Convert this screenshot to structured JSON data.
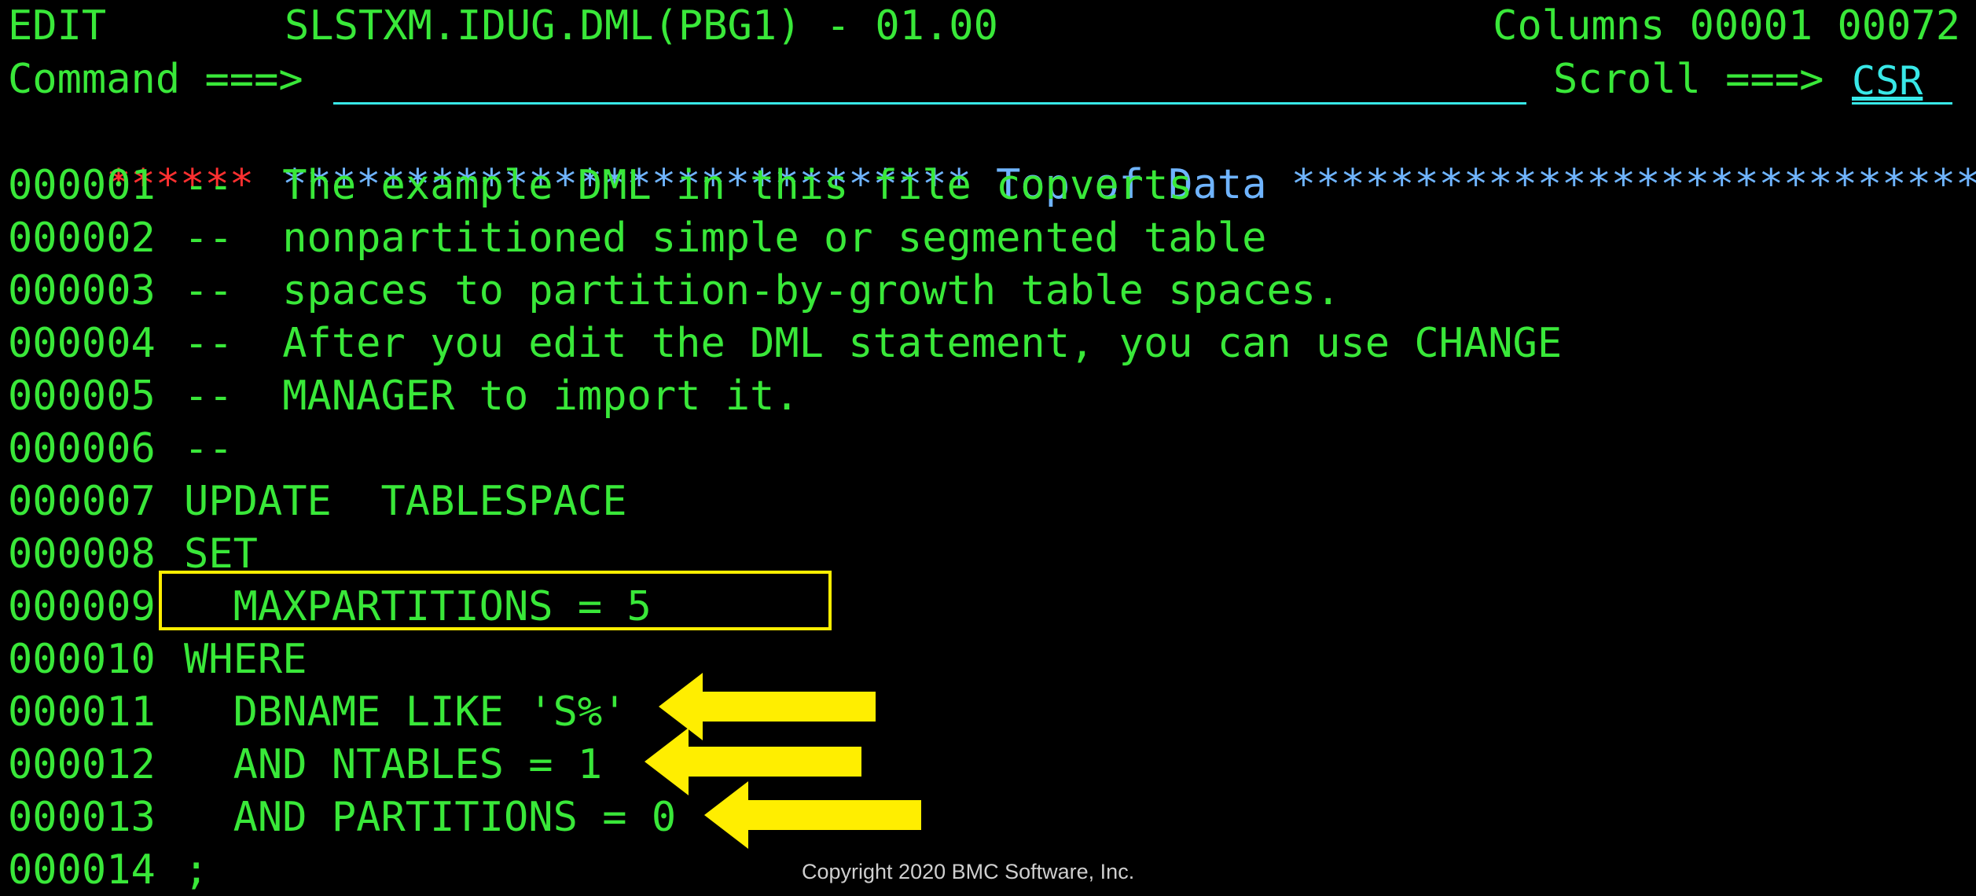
{
  "header": {
    "mode": "EDIT",
    "dataset": "SLSTXM.IDUG.DML(PBG1) - 01.00",
    "columns": "Columns 00001 00072",
    "command_label": "Command ===>",
    "command_value": "",
    "scroll_label": "Scroll ===>",
    "scroll_value": "CSR"
  },
  "top_of_data": {
    "marker": "******",
    "banner": "**************************** Top of Data ******************************"
  },
  "lines": [
    {
      "num": "000001",
      "text": "--  The example DML in this file converts"
    },
    {
      "num": "000002",
      "text": "--  nonpartitioned simple or segmented table"
    },
    {
      "num": "000003",
      "text": "--  spaces to partition-by-growth table spaces."
    },
    {
      "num": "000004",
      "text": "--  After you edit the DML statement, you can use CHANGE"
    },
    {
      "num": "000005",
      "text": "--  MANAGER to import it."
    },
    {
      "num": "000006",
      "text": "--"
    },
    {
      "num": "000007",
      "text": "UPDATE  TABLESPACE"
    },
    {
      "num": "000008",
      "text": "SET"
    },
    {
      "num": "000009",
      "text": "  MAXPARTITIONS = 5"
    },
    {
      "num": "000010",
      "text": "WHERE"
    },
    {
      "num": "000011",
      "text": "  DBNAME LIKE 'S%'"
    },
    {
      "num": "000012",
      "text": "  AND NTABLES = 1"
    },
    {
      "num": "000013",
      "text": "  AND PARTITIONS = 0"
    },
    {
      "num": "000014",
      "text": ";"
    }
  ],
  "copyright": "Copyright 2020 BMC Software, Inc.",
  "colors": {
    "text_green": "#39e839",
    "banner_blue": "#6fb4ff",
    "marker_red": "#ff3030",
    "input_turquoise": "#38e8e8",
    "highlight_yellow": "#ffee00"
  },
  "icons": {
    "arrow": "left-arrow-icon"
  }
}
